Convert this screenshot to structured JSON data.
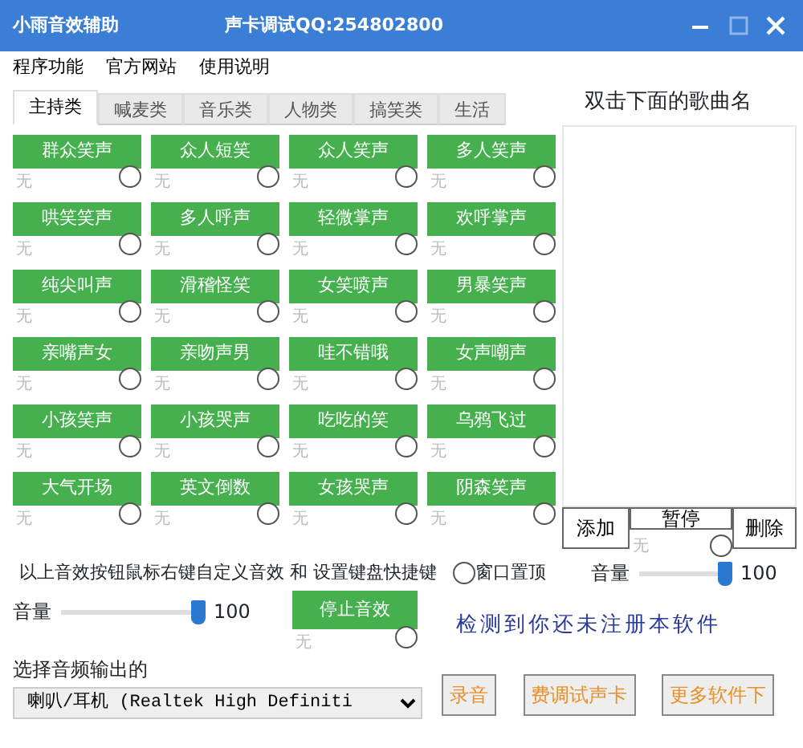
{
  "window": {
    "title": "小雨音效辅助",
    "subtitle": "声卡调试QQ:254802800"
  },
  "menu": [
    "程序功能",
    "官方网站",
    "使用说明"
  ],
  "tabs": [
    {
      "label": "主持类",
      "selected": true
    },
    {
      "label": "喊麦类",
      "selected": false
    },
    {
      "label": "音乐类",
      "selected": false
    },
    {
      "label": "人物类",
      "selected": false
    },
    {
      "label": "搞笑类",
      "selected": false
    },
    {
      "label": "生活",
      "selected": false
    }
  ],
  "effects": [
    {
      "label": "群众笑声",
      "placeholder": "无",
      "checked": false
    },
    {
      "label": "众人短笑",
      "placeholder": "无",
      "checked": false
    },
    {
      "label": "众人笑声",
      "placeholder": "无",
      "checked": false
    },
    {
      "label": "多人笑声",
      "placeholder": "无",
      "checked": false
    },
    {
      "label": "哄笑笑声",
      "placeholder": "无",
      "checked": false
    },
    {
      "label": "多人呼声",
      "placeholder": "无",
      "checked": false
    },
    {
      "label": "轻微掌声",
      "placeholder": "无",
      "checked": false
    },
    {
      "label": "欢呼掌声",
      "placeholder": "无",
      "checked": false
    },
    {
      "label": "纯尖叫声",
      "placeholder": "无",
      "checked": false
    },
    {
      "label": "滑稽怪笑",
      "placeholder": "无",
      "checked": false
    },
    {
      "label": "女笑喷声",
      "placeholder": "无",
      "checked": false
    },
    {
      "label": "男暴笑声",
      "placeholder": "无",
      "checked": false
    },
    {
      "label": "亲嘴声女",
      "placeholder": "无",
      "checked": false
    },
    {
      "label": "亲吻声男",
      "placeholder": "无",
      "checked": false
    },
    {
      "label": "哇不错哦",
      "placeholder": "无",
      "checked": false
    },
    {
      "label": "女声嘲声",
      "placeholder": "无",
      "checked": false
    },
    {
      "label": "小孩笑声",
      "placeholder": "无",
      "checked": false
    },
    {
      "label": "小孩哭声",
      "placeholder": "无",
      "checked": false
    },
    {
      "label": "吃吃的笑",
      "placeholder": "无",
      "checked": false
    },
    {
      "label": "乌鸦飞过",
      "placeholder": "无",
      "checked": false
    },
    {
      "label": "大气开场",
      "placeholder": "无",
      "checked": false
    },
    {
      "label": "英文倒数",
      "placeholder": "无",
      "checked": false
    },
    {
      "label": "女孩哭声",
      "placeholder": "无",
      "checked": false
    },
    {
      "label": "阴森笑声",
      "placeholder": "无",
      "checked": false
    }
  ],
  "playlist": {
    "heading": "双击下面的歌曲名",
    "add": "添加",
    "pause": {
      "label": "暂停",
      "placeholder": "无",
      "checked": false
    },
    "delete": "删除"
  },
  "hint": "以上音效按钮鼠标右键自定义音效 和 设置键盘快捷键",
  "topmost": {
    "label": "窗口置顶",
    "checked": false
  },
  "music_volume": {
    "label": "音量",
    "level": 1,
    "reading": "100"
  },
  "effect_volume": {
    "label": "音量",
    "level": 1,
    "reading": "100"
  },
  "stop": {
    "label": "停止音效",
    "placeholder": "无",
    "checked": false
  },
  "notice": "检测到你还未注册本软件",
  "output": {
    "label": "选择音频输出的",
    "value": "喇叭/耳机 (Realtek High Definiti"
  },
  "buttons": [
    "录音",
    "费调试声卡",
    "更多软件下"
  ]
}
